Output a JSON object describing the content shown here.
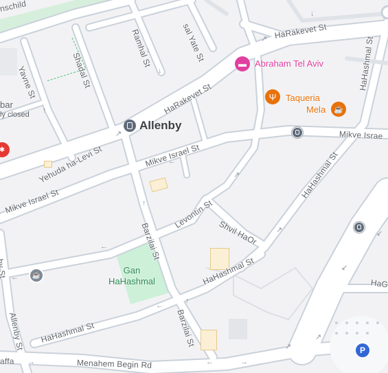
{
  "map": {
    "colors": {
      "background": "#f2f2f4",
      "road": "#c9d1da",
      "park": "#cdf0d8",
      "hotel": "#e040a0",
      "food": "#e8710a",
      "transit": "#5f6b7a",
      "parking": "#3367d6"
    },
    "streets": {
      "schild": "nschild",
      "ramhal": "Ramhal St",
      "yate": "sal Yate St",
      "harakevet_top": "HaRakevet St",
      "shadal": "Shadal St",
      "yavne": "Yavne St",
      "harakevet_mid": "HaRakevet St",
      "hahashmal_right": "HaHashmal St",
      "mikve_right": "Mikve Israe",
      "mikve_mid": "Mikve Israel St",
      "yehuda": "Yehuda ha-Levi St",
      "mikve_left": "Mikve Israel St",
      "hahashmal_diag": "HaHashmal St",
      "levontin": "Levontin St",
      "shvil": "Shvil HaOr",
      "barzilai": "Barzilai St",
      "by_st": "by St",
      "hahashmal_center": "HaHashmal St",
      "hag": "HaG",
      "allenby_st": "Allenby St",
      "hahashmal_bottom": "HaHashmal St",
      "barzilai_bottom": "Barzilai St",
      "jaffa": "affa",
      "menahem": "Menahem Begin Rd"
    },
    "places": {
      "allenby": "Allenby",
      "abraham": "Abraham Tel Aviv",
      "taqueria_line1": "Taqueria",
      "taqueria_line2": "Mela",
      "bar": "bar",
      "closed": "ly closed",
      "park_line1": "Gan",
      "park_line2": "HaHashmal",
      "parking": "P"
    }
  }
}
